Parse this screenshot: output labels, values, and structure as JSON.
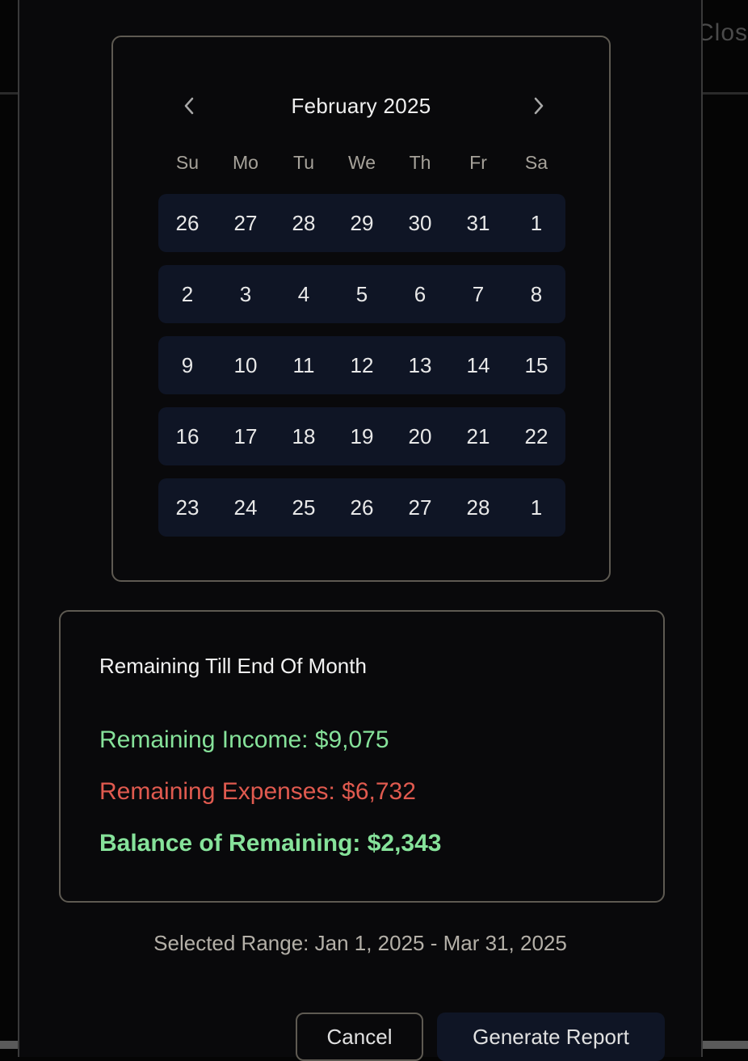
{
  "background": {
    "close_label": "Close"
  },
  "calendar": {
    "month_title": "February 2025",
    "prev_icon": "chevron-left-icon",
    "next_icon": "chevron-right-icon",
    "weekdays": [
      "Su",
      "Mo",
      "Tu",
      "We",
      "Th",
      "Fr",
      "Sa"
    ],
    "weeks": [
      [
        "26",
        "27",
        "28",
        "29",
        "30",
        "31",
        "1"
      ],
      [
        "2",
        "3",
        "4",
        "5",
        "6",
        "7",
        "8"
      ],
      [
        "9",
        "10",
        "11",
        "12",
        "13",
        "14",
        "15"
      ],
      [
        "16",
        "17",
        "18",
        "19",
        "20",
        "21",
        "22"
      ],
      [
        "23",
        "24",
        "25",
        "26",
        "27",
        "28",
        "1"
      ]
    ],
    "range_highlight_color": "#0f1525"
  },
  "summary": {
    "title": "Remaining Till End Of Month",
    "income": "Remaining Income: $9,075",
    "expenses": "Remaining Expenses: $6,732",
    "balance": "Balance of Remaining: $2,343",
    "income_color": "#86e29a",
    "expenses_color": "#e05a4f"
  },
  "selected_range": "Selected Range: Jan 1, 2025 - Mar 31, 2025",
  "buttons": {
    "cancel": "Cancel",
    "generate": "Generate Report"
  }
}
